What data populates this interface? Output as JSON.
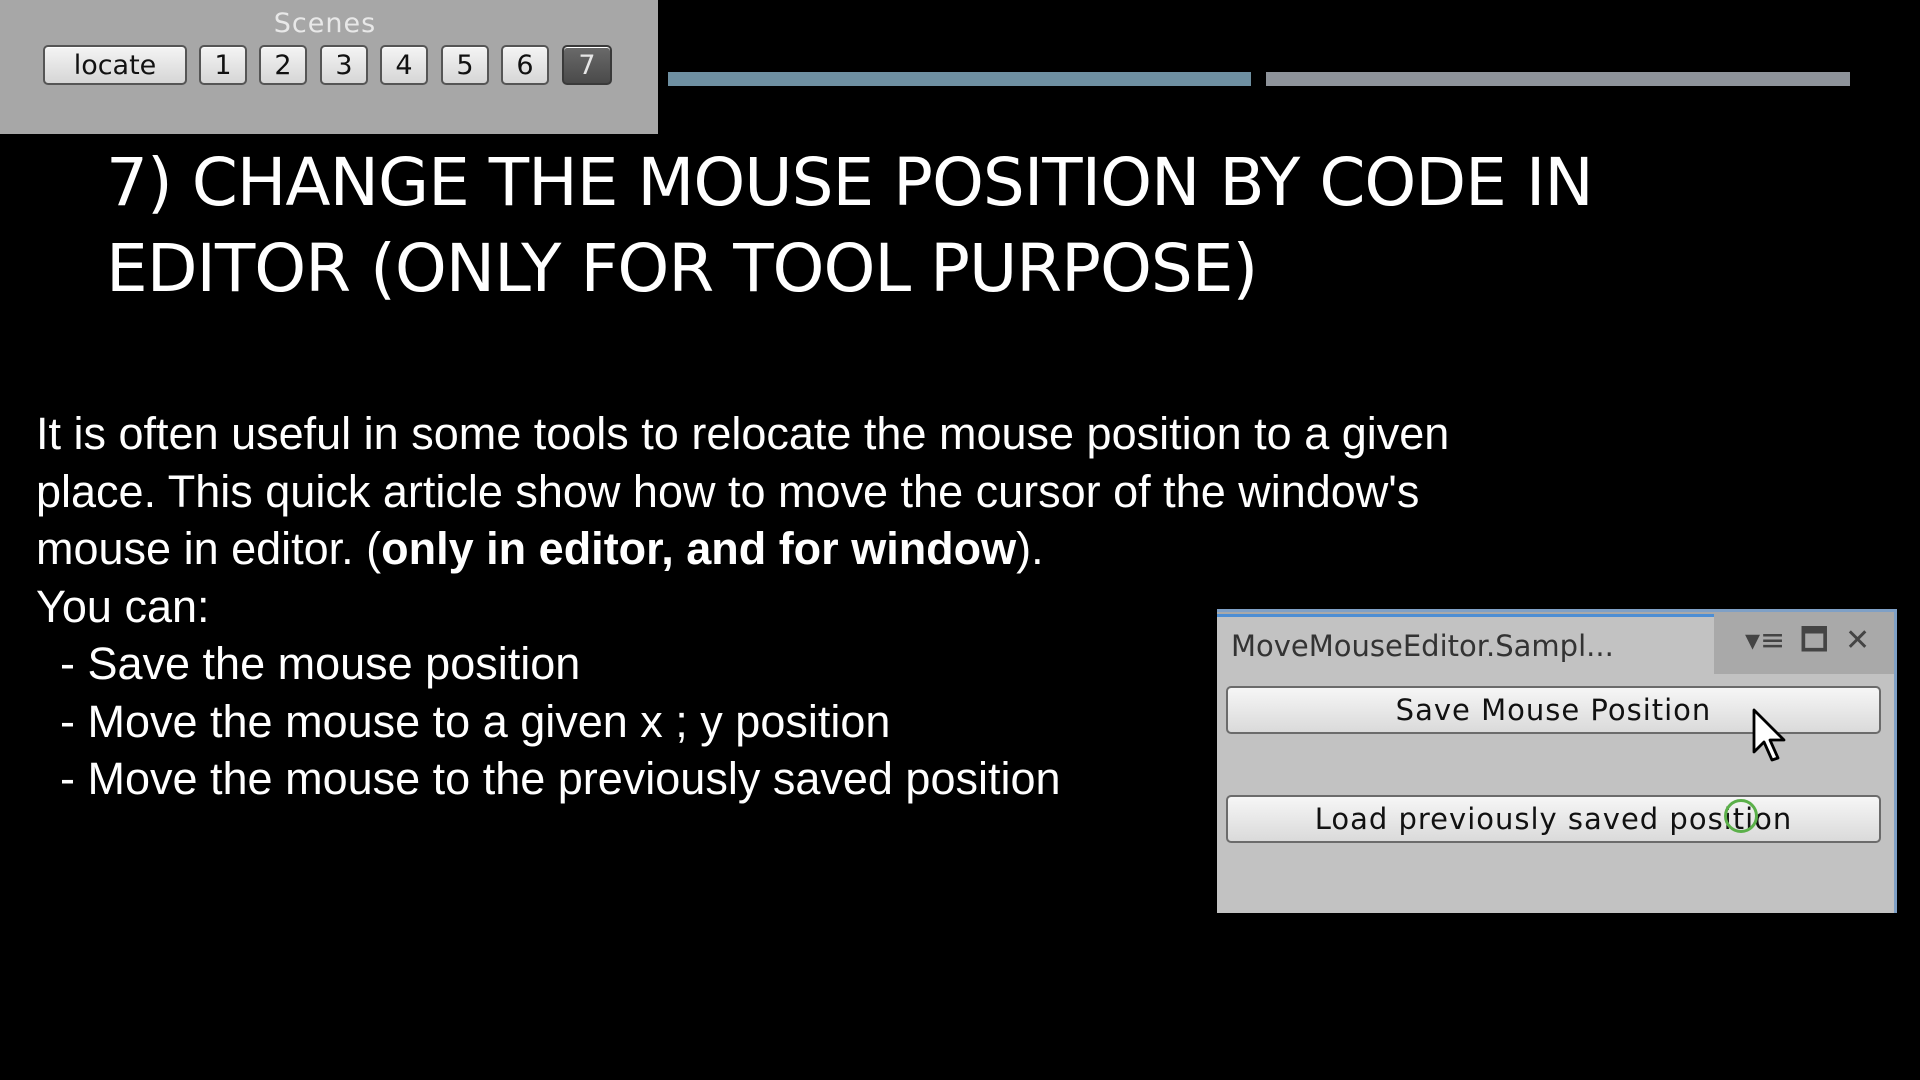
{
  "scenes_panel": {
    "title": "Scenes",
    "locate_label": "locate",
    "scene_buttons": [
      "1",
      "2",
      "3",
      "4",
      "5",
      "6",
      "7"
    ],
    "active_scene": "7"
  },
  "progress": {
    "segments": [
      {
        "color": "#6e8fa1"
      },
      {
        "color": "#8e939a"
      }
    ]
  },
  "slide": {
    "title_line1": "7) CHANGE THE MOUSE POSITION BY CODE IN",
    "title_line2": "EDITOR (ONLY FOR TOOL PURPOSE)",
    "para_line1": "It is often useful in some tools to relocate the mouse position to a given",
    "para_line2": "place. This quick article show how to move the cursor of the window's",
    "para_line3_start": "mouse in editor. (",
    "para_line3_bold": "only in editor, and for window",
    "para_line3_end": ").",
    "you_can": "You can:",
    "bullets": [
      "- Save the mouse position",
      "- Move the mouse to a given x ; y position",
      "- Move the mouse to the previously saved position"
    ]
  },
  "editor_window": {
    "tab_title": "MoveMouseEditor.Sampl...",
    "icons": [
      "menu-icon",
      "maximize-icon",
      "close-icon"
    ],
    "save_button": "Save Mouse Position",
    "load_button": "Load previously saved position",
    "accent_color": "#4d8ed4"
  }
}
